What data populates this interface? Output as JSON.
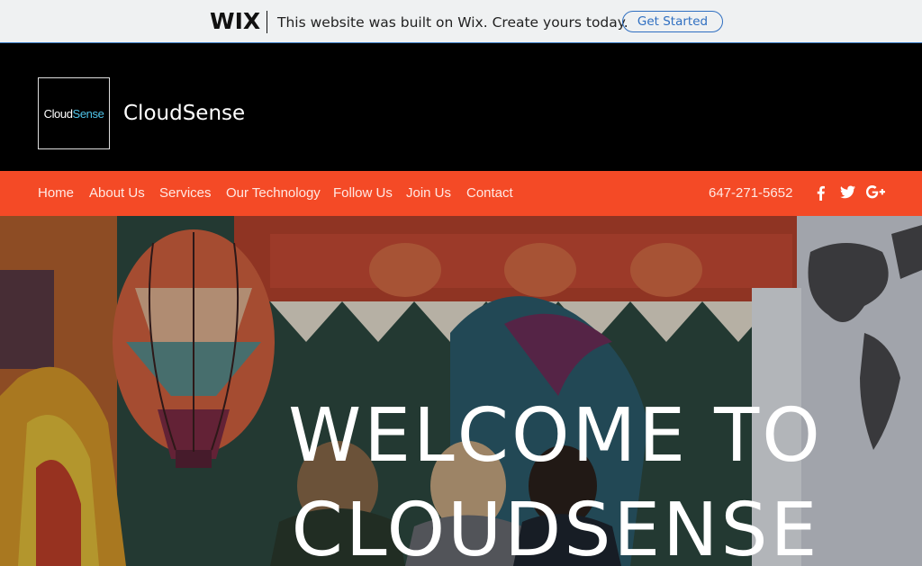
{
  "wix_bar": {
    "logo": "WIX",
    "message": "This website was built on Wix. Create yours today.",
    "cta_label": "Get Started",
    "accent": "#2f6fc1"
  },
  "header": {
    "logo_text_1": "Cloud",
    "logo_text_2": "Sense",
    "site_name": "CloudSense"
  },
  "nav": {
    "items": [
      "Home",
      "About Us",
      "Services",
      "Our Technology",
      "Follow Us",
      "Join Us",
      "Contact"
    ],
    "phone": "647-271-5652",
    "social_icons": [
      "facebook-icon",
      "twitter-icon",
      "google-plus-icon"
    ],
    "background": "#f44a26"
  },
  "hero": {
    "title_line_1": "WELCOME TO",
    "title_line_2": "CLOUDSENSE"
  }
}
